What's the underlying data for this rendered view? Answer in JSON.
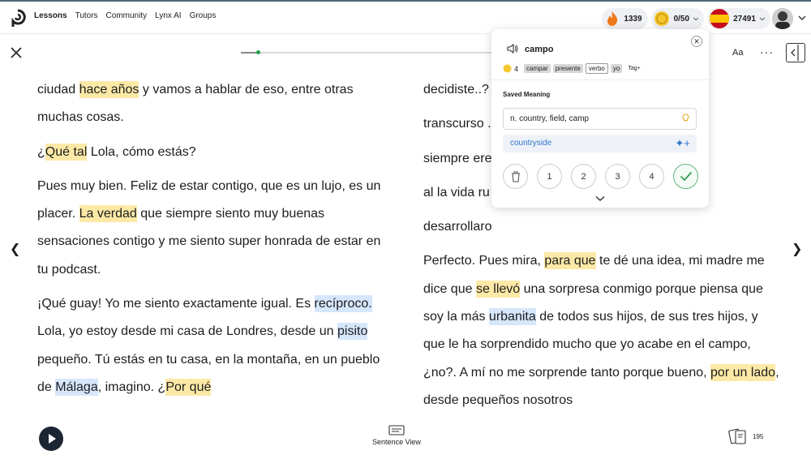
{
  "nav": {
    "items": [
      "Lessons",
      "Tutors",
      "Community",
      "Lynx AI",
      "Groups"
    ]
  },
  "stats": {
    "streak": "1339",
    "coins": "0/50",
    "words": "27491"
  },
  "toolbar": {
    "font_label": "Aa",
    "more_label": "···"
  },
  "reader": {
    "left": [
      [
        {
          "t": "ciudad "
        },
        {
          "t": "hace años",
          "h": "y"
        },
        {
          "t": " y vamos a hablar de eso, entre otras muchas cosas."
        }
      ],
      [
        {
          "t": "¿"
        },
        {
          "t": "Qué tal",
          "h": "y"
        },
        {
          "t": " Lola, cómo estás?"
        }
      ],
      [
        {
          "t": "Pues muy bien. Feliz de estar contigo, que es un lujo, es un placer. "
        },
        {
          "t": "La verdad",
          "h": "y"
        },
        {
          "t": " que siempre siento muy buenas sensaciones contigo y me siento super honrada de estar en tu podcast."
        }
      ],
      [
        {
          "t": "¡Qué guay! Yo me siento exactamente igual. Es "
        },
        {
          "t": "recíproco.",
          "h": "b"
        },
        {
          "t": " Lola, yo estoy desde mi casa de Londres, desde un "
        },
        {
          "t": "pisito",
          "h": "b"
        },
        {
          "t": " pequeño. Tú estás en tu casa, en la montaña, en un pueblo de "
        },
        {
          "t": "Málaga",
          "h": "b"
        },
        {
          "t": ", imagino. ¿"
        },
        {
          "t": "Por qué",
          "h": "y"
        }
      ]
    ],
    "right": [
      [
        {
          "t": "decidiste..? ..."
        },
        {
          "t": "l"
        }
      ],
      [
        {
          "t": "transcurso ..."
        },
        {
          "t": "campo",
          "h": "s"
        },
        {
          "t": " o"
        }
      ],
      [
        {
          "t": "siempre ere ... e cambio"
        }
      ],
      [
        {
          "t": "al la vida ru"
        }
      ],
      [
        {
          "t": "desarrollaro"
        }
      ],
      [
        {
          "t": "Perfecto. Pues mira, "
        },
        {
          "t": "para que",
          "h": "y"
        },
        {
          "t": " te dé una idea, mi madre me dice que "
        },
        {
          "t": "se llevó",
          "h": "y"
        },
        {
          "t": " una sorpresa conmigo porque piensa que soy la más "
        },
        {
          "t": "urbanita",
          "h": "b"
        },
        {
          "t": " de todos sus hijos, de sus tres hijos, y que le ha sorprendido mucho que yo acabe en el campo, ¿no?. A mí no me sorprende tanto porque bueno, "
        },
        {
          "t": "por un lado",
          "h": "y"
        },
        {
          "t": ", desde pequeños nosotros"
        }
      ]
    ]
  },
  "popup": {
    "word": "campo",
    "count": "4",
    "tags": [
      "campar",
      "presente",
      "verbo",
      "yo"
    ],
    "tag_add": "Tag+",
    "saved_label": "Saved Meaning",
    "meaning": "n. country, field, camp",
    "suggestion": "countryside",
    "levels": [
      "1",
      "2",
      "3",
      "4"
    ]
  },
  "bottom": {
    "sentence_view": "Sentence View",
    "cards_count": "195"
  },
  "colors": {
    "highlight_yellow": "#fde9a6",
    "highlight_blue": "#d6e6fb",
    "known_green": "#62b57b",
    "link_blue": "#2f74c9"
  }
}
